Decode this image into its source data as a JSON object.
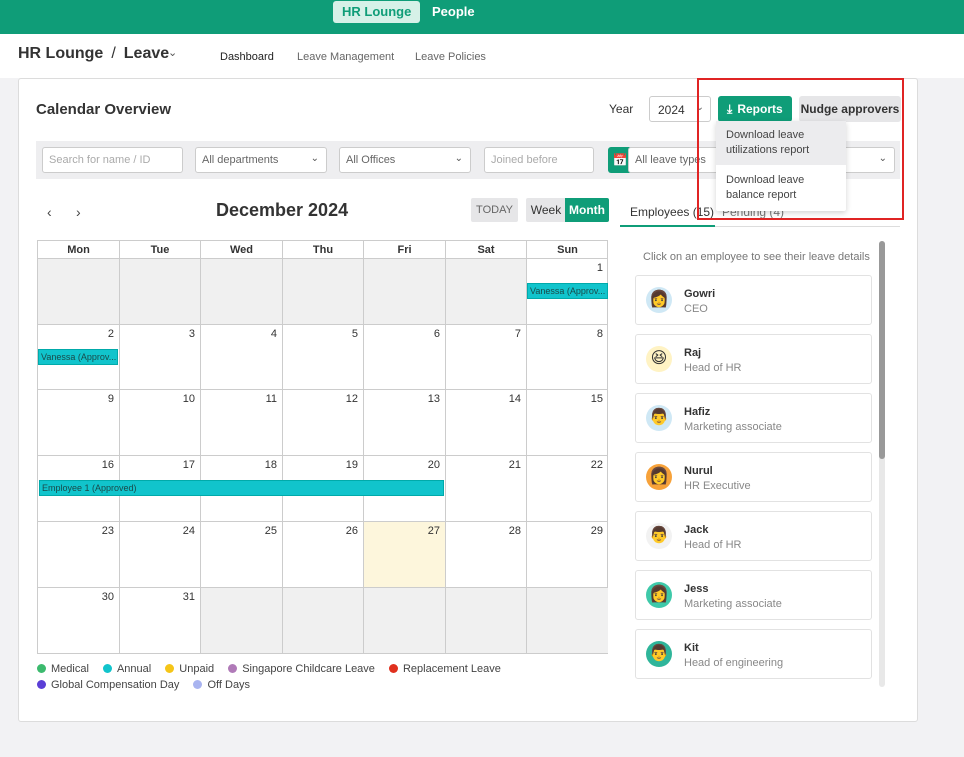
{
  "topbar": {
    "tabs": [
      {
        "label": "HR Lounge",
        "active": true
      },
      {
        "label": "People",
        "active": false
      }
    ]
  },
  "breadcrumb": {
    "root": "HR Lounge",
    "separator": "/",
    "current": "Leave"
  },
  "subnav": [
    "Dashboard",
    "Leave Management",
    "Leave Policies"
  ],
  "overview": {
    "title": "Calendar Overview",
    "year_label": "Year",
    "year_value": "2024",
    "reports_label": "Reports",
    "nudge_label": "Nudge approvers"
  },
  "reports_menu": [
    "Download leave utilizations report",
    "Download leave balance report"
  ],
  "filters": {
    "search_placeholder": "Search for name / ID",
    "department": "All departments",
    "office": "All Offices",
    "joined_placeholder": "Joined before",
    "leave_type": "All leave types"
  },
  "calendar": {
    "month_title": "December 2024",
    "today_label": "TODAY",
    "week_label": "Week",
    "month_label": "Month",
    "weekdays": [
      "Mon",
      "Tue",
      "Wed",
      "Thu",
      "Fri",
      "Sat",
      "Sun"
    ],
    "days": {
      "d1": "1",
      "d2": "2",
      "d3": "3",
      "d4": "4",
      "d5": "5",
      "d6": "6",
      "d7": "7",
      "d8": "8",
      "d9": "9",
      "d10": "10",
      "d11": "11",
      "d12": "12",
      "d13": "13",
      "d14": "14",
      "d15": "15",
      "d16": "16",
      "d17": "17",
      "d18": "18",
      "d19": "19",
      "d20": "20",
      "d21": "21",
      "d22": "22",
      "d23": "23",
      "d24": "24",
      "d25": "25",
      "d26": "26",
      "d27": "27",
      "d28": "28",
      "d29": "29",
      "d30": "30",
      "d31": "31"
    },
    "events": {
      "vanessa_1": "Vanessa (Approv...",
      "vanessa_2": "Vanessa (Approv...",
      "employee1": "Employee 1 (Approved)"
    },
    "event_color": "#11c4cc",
    "today_highlight": "#fdf6dc"
  },
  "legend": [
    {
      "label": "Medical",
      "color": "#3cba6e"
    },
    {
      "label": "Annual",
      "color": "#11c4cc"
    },
    {
      "label": "Unpaid",
      "color": "#f5c518"
    },
    {
      "label": "Singapore Childcare Leave",
      "color": "#b07ab8"
    },
    {
      "label": "Replacement Leave",
      "color": "#e0301e"
    },
    {
      "label": "Global Compensation Day",
      "color": "#5b3fd6"
    },
    {
      "label": "Off Days",
      "color": "#a9b4f0"
    }
  ],
  "panel": {
    "tab_employees": "Employees (15)",
    "tab_pending": "Pending (4)",
    "hint": "Click on an employee to see their leave details",
    "employees": [
      {
        "name": "Gowri",
        "role": "CEO",
        "avatar": "woman-avatar",
        "glyph": "👩"
      },
      {
        "name": "Raj",
        "role": "Head of HR",
        "avatar": "laughing-face-avatar",
        "glyph": "😆"
      },
      {
        "name": "Hafiz",
        "role": "Marketing associate",
        "avatar": "man-avatar",
        "glyph": "👨"
      },
      {
        "name": "Nurul",
        "role": "HR Executive",
        "avatar": "woman-avatar",
        "glyph": "👩"
      },
      {
        "name": "Jack",
        "role": "Head of HR",
        "avatar": "man-in-suit-avatar",
        "glyph": "👨"
      },
      {
        "name": "Jess",
        "role": "Marketing associate",
        "avatar": "woman-avatar",
        "glyph": "👩"
      },
      {
        "name": "Kit",
        "role": "Head of engineering",
        "avatar": "man-avatar",
        "glyph": "👨"
      }
    ]
  },
  "brand_color": "#0f9d78"
}
